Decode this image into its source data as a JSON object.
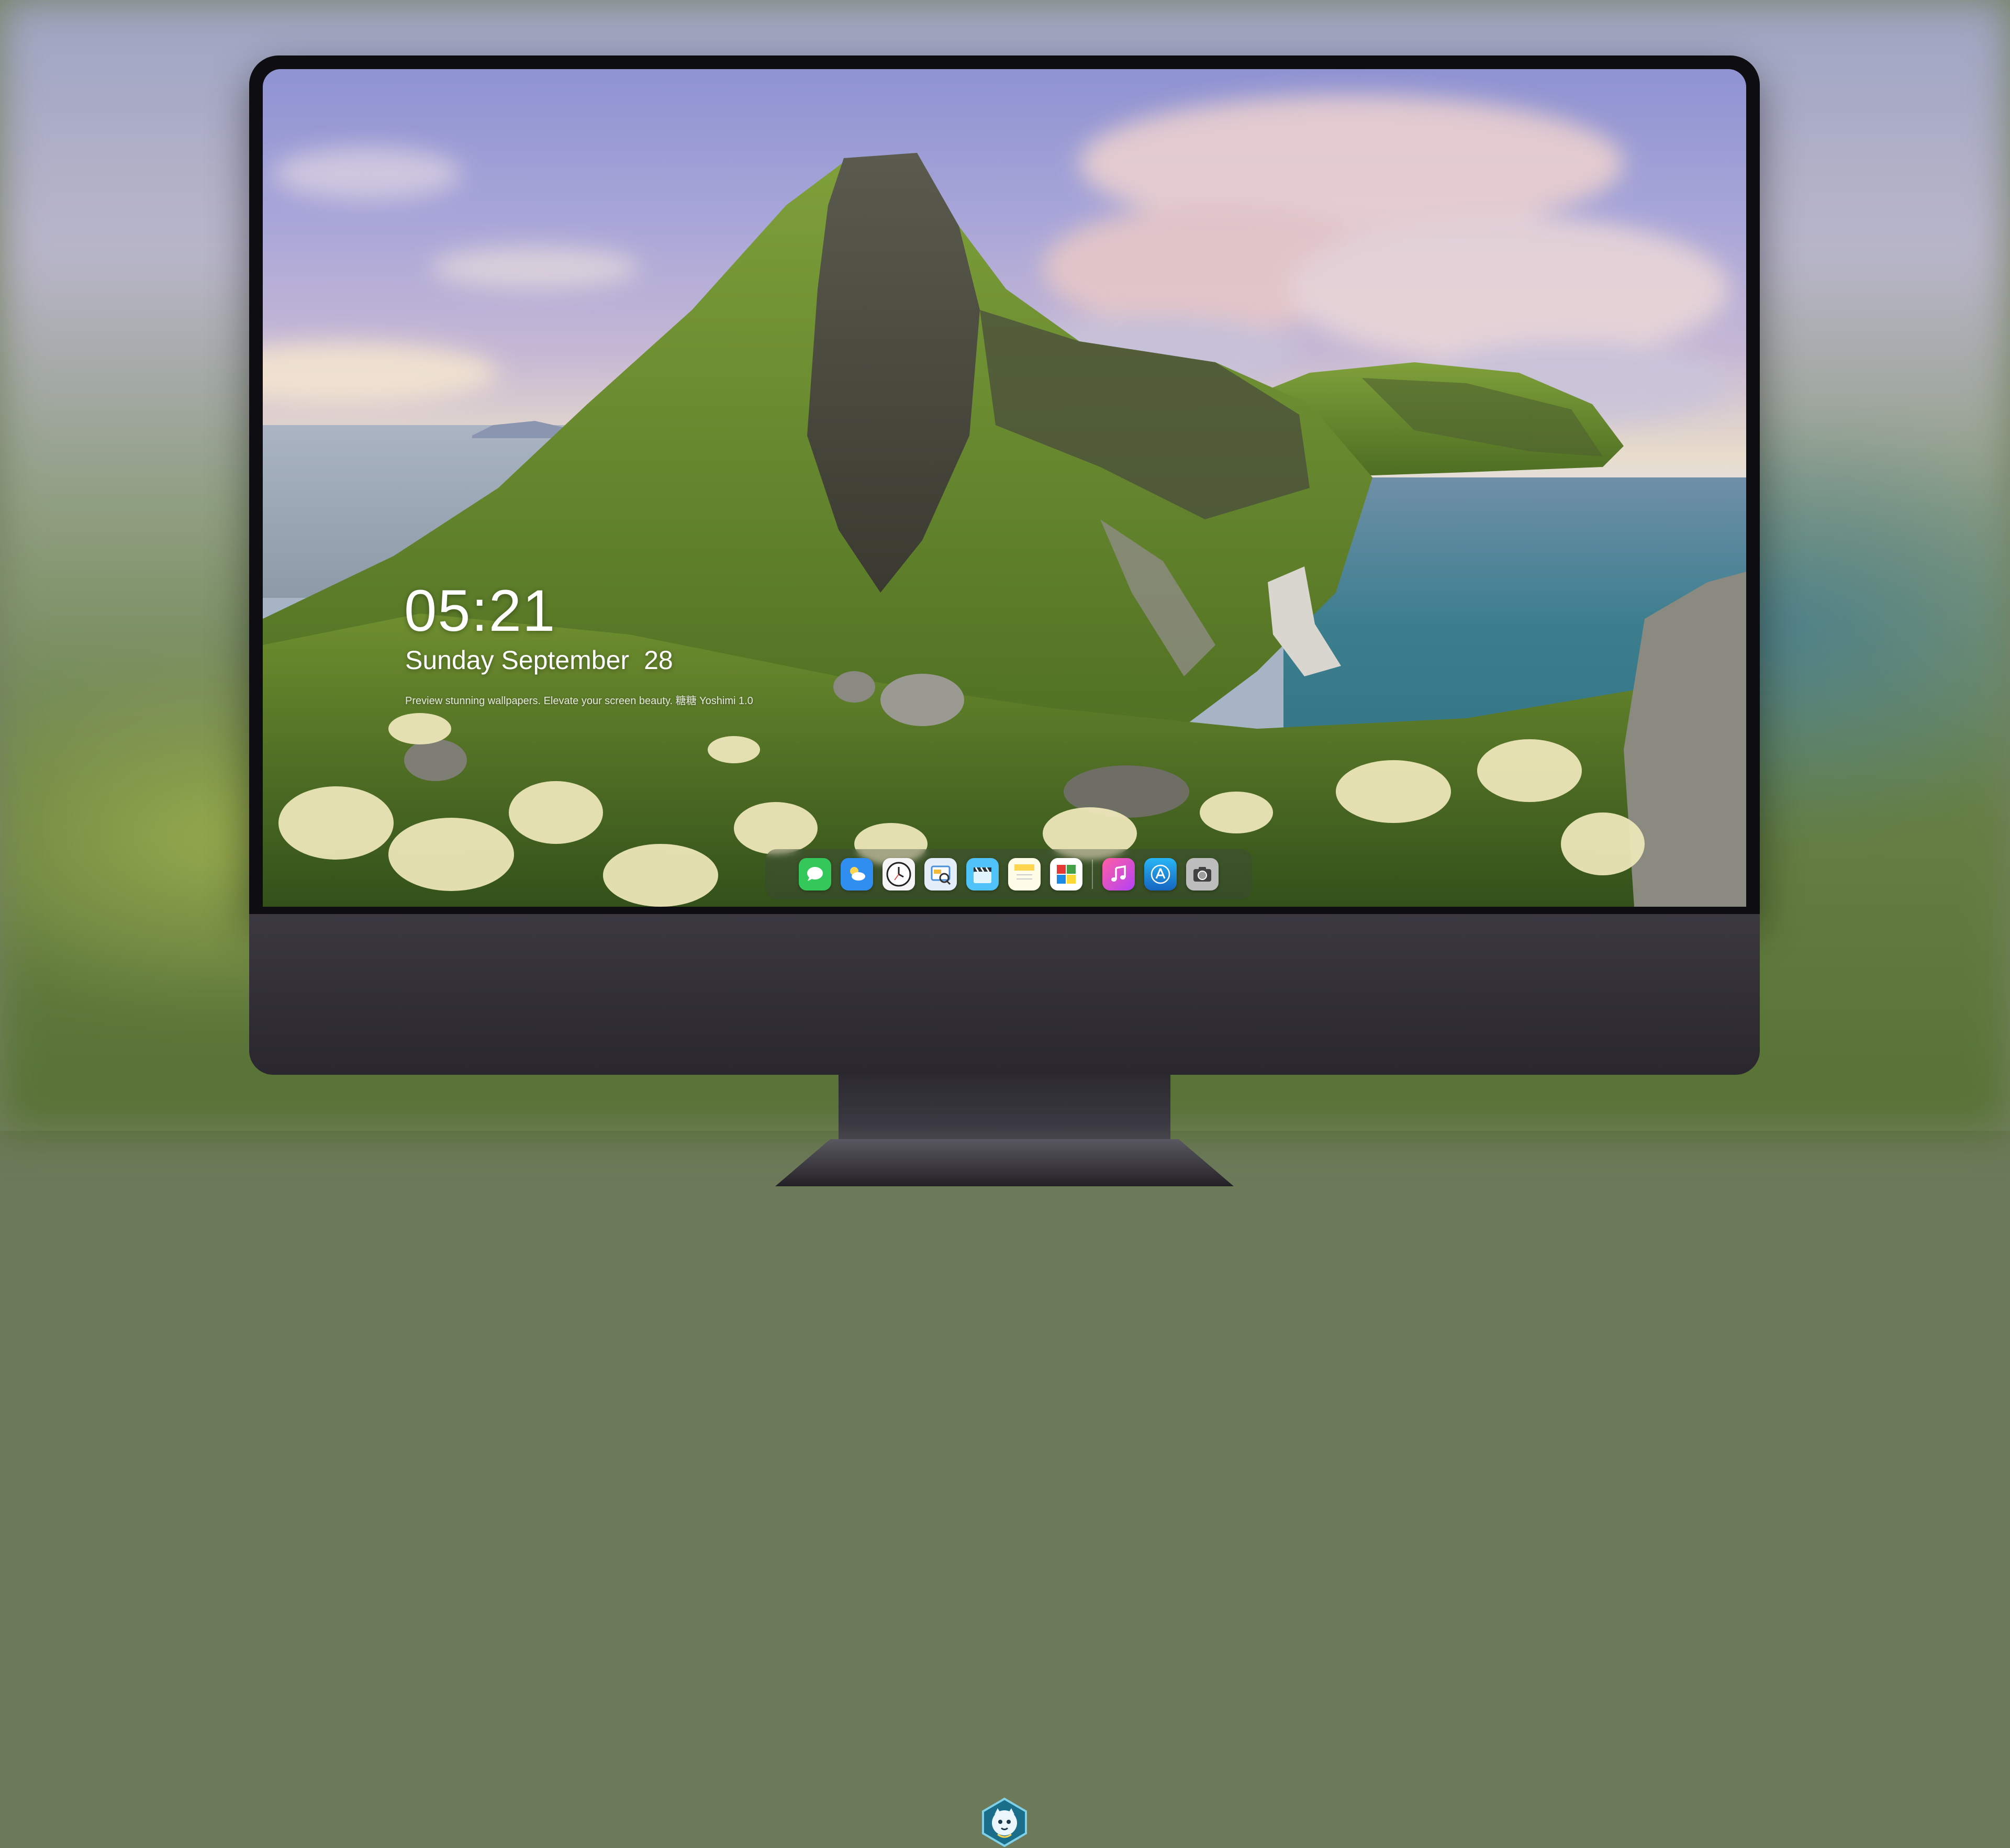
{
  "lockscreen": {
    "time": "05:21",
    "weekday_month": "Sunday September",
    "day": "28",
    "tagline": "Preview stunning wallpapers. Elevate your screen beauty. 糖糖 Yoshimi 1.0"
  },
  "dock": {
    "apps": [
      {
        "icon": "messages-icon",
        "color": "#34c759"
      },
      {
        "icon": "weather-icon",
        "color": "#2f8ef0"
      },
      {
        "icon": "clock-icon",
        "color": "#ffffff"
      },
      {
        "icon": "preview-icon",
        "color": "#4a90d9"
      },
      {
        "icon": "claquette-icon",
        "color": "#4fc3f7"
      },
      {
        "icon": "notes-icon",
        "color": "#ffd54f"
      },
      {
        "icon": "photo-booth-icon",
        "color": "#8bc34a"
      },
      {
        "icon": "music-icon",
        "color": "#e040fb"
      },
      {
        "icon": "app-store-icon",
        "color": "#1e88e5"
      },
      {
        "icon": "camera-icon",
        "color": "#9e9e9e"
      }
    ]
  },
  "colors": {
    "bezel": "#0d0d12",
    "chin": "#35323a",
    "time_text": "#ffffff"
  }
}
